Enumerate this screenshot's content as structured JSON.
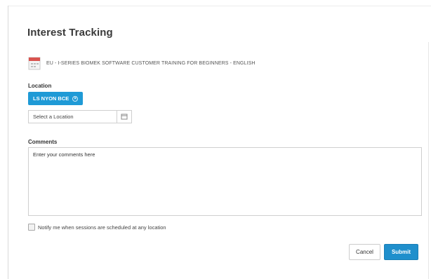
{
  "dialog": {
    "title": "Interest Tracking"
  },
  "course": {
    "icon": "calendar-icon",
    "title": "EU - I-SERIES BIOMEK SOFTWARE CUSTOMER TRAINING FOR BEGINNERS - ENGLISH"
  },
  "location": {
    "label": "Location",
    "selected_chip": "LS NYON BCE",
    "chip_remove_icon": "remove-circle-icon",
    "select_placeholder": "Select a Location",
    "picker_icon": "picker-icon"
  },
  "comments": {
    "label": "Comments",
    "placeholder": "Enter your comments here",
    "value": ""
  },
  "notify": {
    "label": "Notify me when sessions are scheduled at any location",
    "checked": false
  },
  "actions": {
    "cancel_label": "Cancel",
    "submit_label": "Submit"
  },
  "colors": {
    "accent": "#1f9ad6",
    "submit": "#1f8fcc"
  }
}
